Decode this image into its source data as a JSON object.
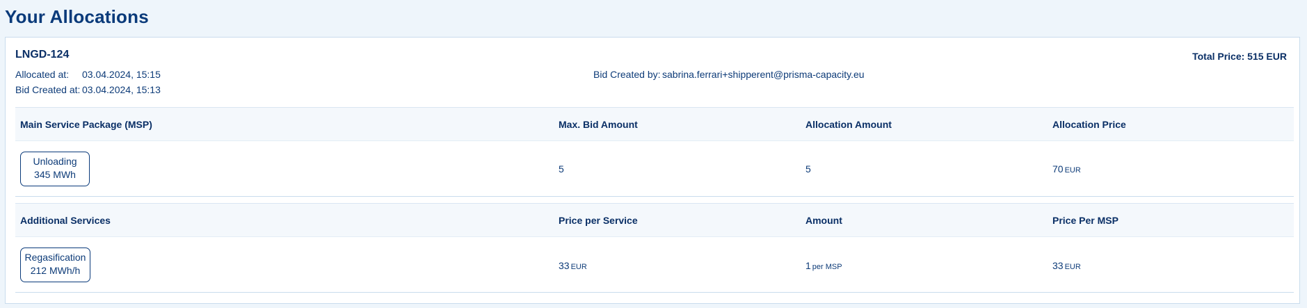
{
  "page": {
    "title": "Your Allocations"
  },
  "allocation": {
    "id": "LNGD-124",
    "total_price_label": "Total Price: 515 EUR",
    "allocated_at_label": "Allocated at:",
    "allocated_at_value": "03.04.2024, 15:15",
    "bid_created_at_label": "Bid Created at:",
    "bid_created_at_value": "03.04.2024, 15:13",
    "bid_created_by_label": "Bid Created by:",
    "bid_created_by_value": "sabrina.ferrari+shipperent@prisma-capacity.eu"
  },
  "msp": {
    "headers": [
      "Main Service Package (MSP)",
      "Max. Bid Amount",
      "Allocation Amount",
      "Allocation Price"
    ],
    "service_name": "Unloading",
    "service_capacity": "345 MWh",
    "max_bid_amount": "5",
    "allocation_amount": "5",
    "allocation_price": "70",
    "allocation_price_unit": "EUR"
  },
  "additional": {
    "headers": [
      "Additional Services",
      "Price per Service",
      "Amount",
      "Price Per MSP"
    ],
    "service_name": "Regasification",
    "service_capacity": "212 MWh/h",
    "price_per_service": "33",
    "price_per_service_unit": "EUR",
    "amount": "1",
    "amount_unit": "per MSP",
    "price_per_msp": "33",
    "price_per_msp_unit": "EUR"
  }
}
